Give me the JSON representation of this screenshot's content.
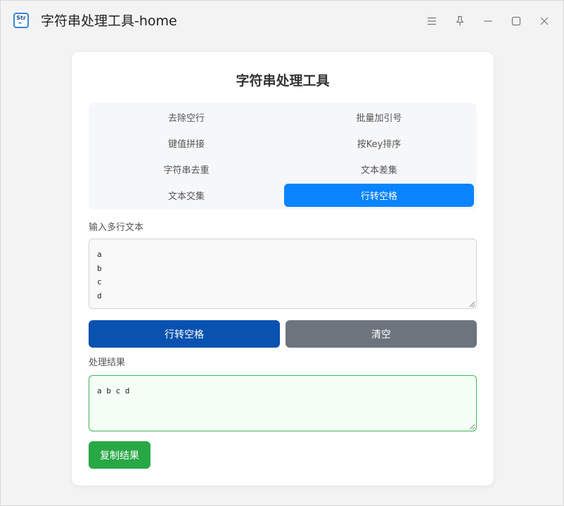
{
  "window": {
    "title": "字符串处理工具-home",
    "app_icon_text": "Str",
    "controls": [
      "menu-icon",
      "pin-icon",
      "minimize-icon",
      "maximize-icon",
      "close-icon"
    ]
  },
  "card": {
    "title": "字符串处理工具",
    "tabs": [
      {
        "label": "去除空行",
        "active": false
      },
      {
        "label": "批量加引号",
        "active": false
      },
      {
        "label": "键值拼接",
        "active": false
      },
      {
        "label": "按Key排序",
        "active": false
      },
      {
        "label": "字符串去重",
        "active": false
      },
      {
        "label": "文本差集",
        "active": false
      },
      {
        "label": "文本交集",
        "active": false
      },
      {
        "label": "行转空格",
        "active": true
      }
    ],
    "input_label": "输入多行文本",
    "input_value": "a\nb\nc\nd",
    "process_button": "行转空格",
    "clear_button": "清空",
    "result_label": "处理结果",
    "result_value": "a b c d",
    "copy_button": "复制结果"
  },
  "colors": {
    "accent": "#0a84ff",
    "process_button": "#0a52b0",
    "clear_button": "#6c757d",
    "copy_button": "#28a745",
    "result_border": "#3cb65a"
  }
}
